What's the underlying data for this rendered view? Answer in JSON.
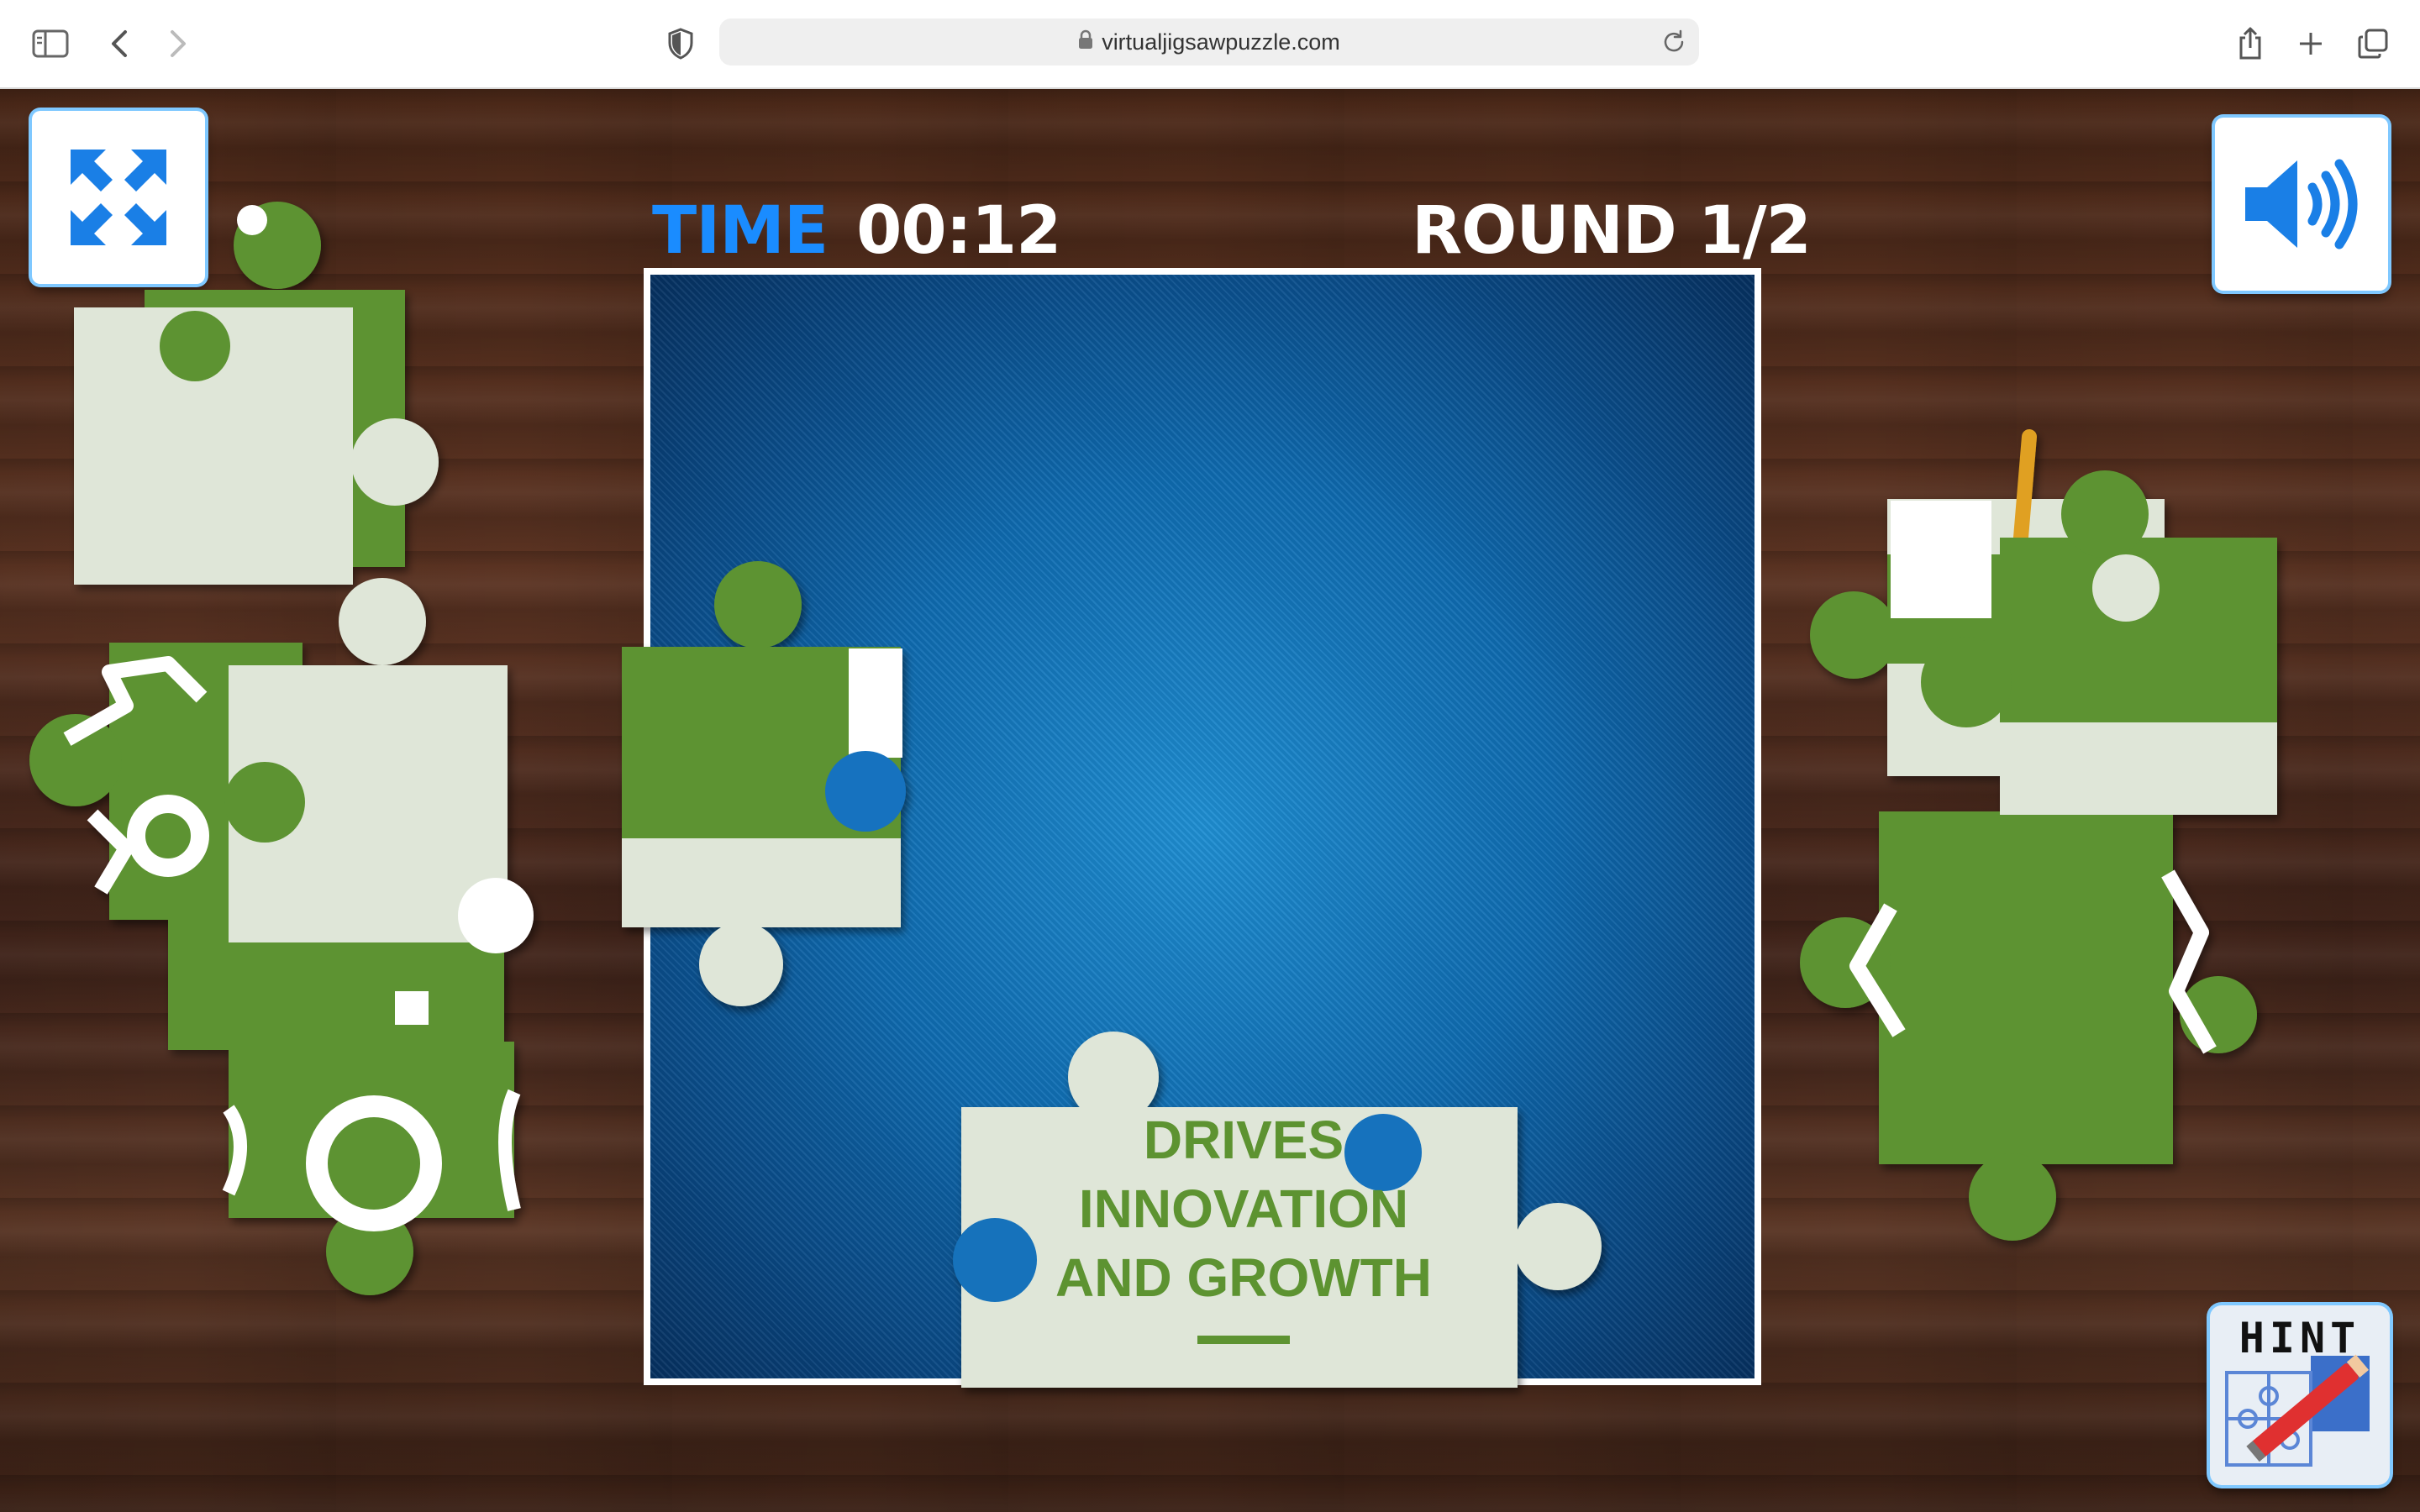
{
  "browser": {
    "url": "virtualjigsawpuzzle.com"
  },
  "hud": {
    "time_label": "TIME",
    "time_value": "00:12",
    "round_text": "ROUND 1/2"
  },
  "puzzle": {
    "piece_text_lines": [
      "DRIVES",
      "INNOVATION",
      "AND GROWTH"
    ]
  },
  "buttons": {
    "hint_label": "HINT"
  },
  "colors": {
    "accent_blue": "#1a8cff",
    "piece_green": "#5d9331",
    "piece_white": "#dfe6d8"
  },
  "icons": [
    "sidebar-icon",
    "back-icon",
    "forward-icon",
    "shield-icon",
    "lock-icon",
    "reload-icon",
    "share-icon",
    "new-tab-icon",
    "tabs-icon",
    "fullscreen-icon",
    "speaker-icon",
    "hint-icon"
  ]
}
